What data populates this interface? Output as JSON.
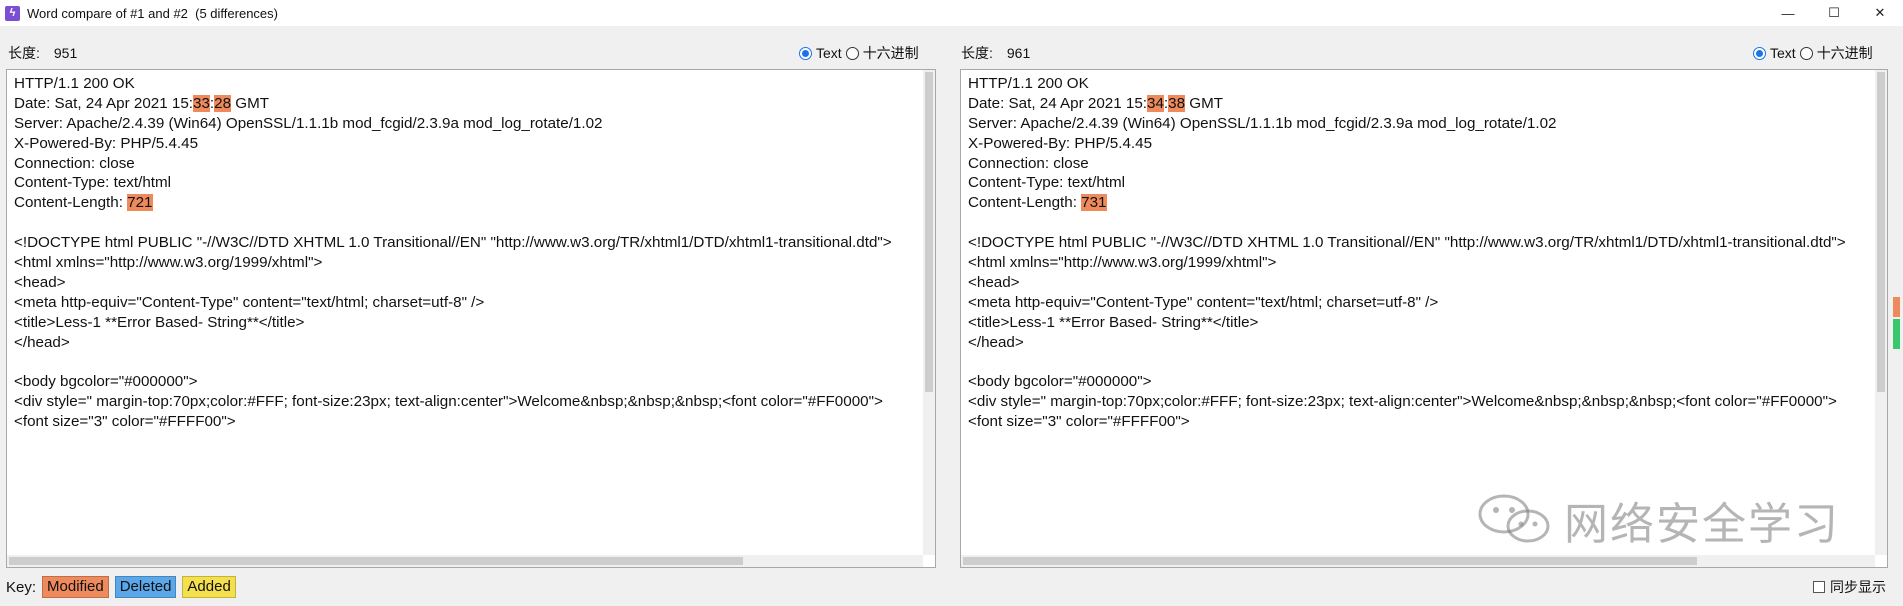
{
  "window": {
    "title": "Word compare of #1 and #2  (5 differences)",
    "icon": "lightning-icon",
    "controls": {
      "minimize": "—",
      "maximize": "☐",
      "close": "✕"
    }
  },
  "left": {
    "length_label": "长度:",
    "length_value": "951",
    "mode_text": "Text",
    "mode_hex": "十六进制",
    "lines": [
      {
        "pre": "HTTP/1.1 200 OK"
      },
      {
        "pre": "Date: Sat, 24 Apr 2021 15:",
        "m1": "33",
        "mid": ":",
        "m2": "28",
        "post": " GMT"
      },
      {
        "pre": "Server: Apache/2.4.39 (Win64) OpenSSL/1.1.1b mod_fcgid/2.3.9a mod_log_rotate/1.02"
      },
      {
        "pre": "X-Powered-By: PHP/5.4.45"
      },
      {
        "pre": "Connection: close"
      },
      {
        "pre": "Content-Type: text/html"
      },
      {
        "pre": "Content-Length: ",
        "m1": "721"
      },
      {
        "pre": ""
      },
      {
        "pre": "<!DOCTYPE html PUBLIC \"-//W3C//DTD XHTML 1.0 Transitional//EN\" \"http://www.w3.org/TR/xhtml1/DTD/xhtml1-transitional.dtd\">"
      },
      {
        "pre": "<html xmlns=\"http://www.w3.org/1999/xhtml\">"
      },
      {
        "pre": "<head>"
      },
      {
        "pre": "<meta http-equiv=\"Content-Type\" content=\"text/html; charset=utf-8\" />"
      },
      {
        "pre": "<title>Less-1 **Error Based- String**</title>"
      },
      {
        "pre": "</head>"
      },
      {
        "pre": ""
      },
      {
        "pre": "<body bgcolor=\"#000000\">"
      },
      {
        "pre": "<div style=\" margin-top:70px;color:#FFF; font-size:23px; text-align:center\">Welcome&nbsp;&nbsp;&nbsp;<font color=\"#FF0000\">"
      },
      {
        "pre": "<font size=\"3\" color=\"#FFFF00\">"
      }
    ]
  },
  "right": {
    "length_label": "长度:",
    "length_value": "961",
    "mode_text": "Text",
    "mode_hex": "十六进制",
    "lines": [
      {
        "pre": "HTTP/1.1 200 OK"
      },
      {
        "pre": "Date: Sat, 24 Apr 2021 15:",
        "m1": "34",
        "mid": ":",
        "m2": "38",
        "post": " GMT"
      },
      {
        "pre": "Server: Apache/2.4.39 (Win64) OpenSSL/1.1.1b mod_fcgid/2.3.9a mod_log_rotate/1.02"
      },
      {
        "pre": "X-Powered-By: PHP/5.4.45"
      },
      {
        "pre": "Connection: close"
      },
      {
        "pre": "Content-Type: text/html"
      },
      {
        "pre": "Content-Length: ",
        "m1": "731"
      },
      {
        "pre": ""
      },
      {
        "pre": "<!DOCTYPE html PUBLIC \"-//W3C//DTD XHTML 1.0 Transitional//EN\" \"http://www.w3.org/TR/xhtml1/DTD/xhtml1-transitional.dtd\">"
      },
      {
        "pre": "<html xmlns=\"http://www.w3.org/1999/xhtml\">"
      },
      {
        "pre": "<head>"
      },
      {
        "pre": "<meta http-equiv=\"Content-Type\" content=\"text/html; charset=utf-8\" />"
      },
      {
        "pre": "<title>Less-1 **Error Based- String**</title>"
      },
      {
        "pre": "</head>"
      },
      {
        "pre": ""
      },
      {
        "pre": "<body bgcolor=\"#000000\">"
      },
      {
        "pre": "<div style=\" margin-top:70px;color:#FFF; font-size:23px; text-align:center\">Welcome&nbsp;&nbsp;&nbsp;<font color=\"#FF0000\">"
      },
      {
        "pre": "<font size=\"3\" color=\"#FFFF00\">"
      }
    ]
  },
  "footer": {
    "key_label": "Key:",
    "modified": "Modified",
    "deleted": "Deleted",
    "added": "Added",
    "sync_label": "同步显示"
  },
  "watermark": {
    "text": "网络安全学习",
    "icon": "wechat-icon"
  },
  "colors": {
    "modified": "#ee8a5c",
    "deleted": "#5aa7ea",
    "added": "#f4e04d",
    "radio_accent": "#1a73e8",
    "overview_modified": "#ee8a5c",
    "overview_added": "#38c76a"
  }
}
